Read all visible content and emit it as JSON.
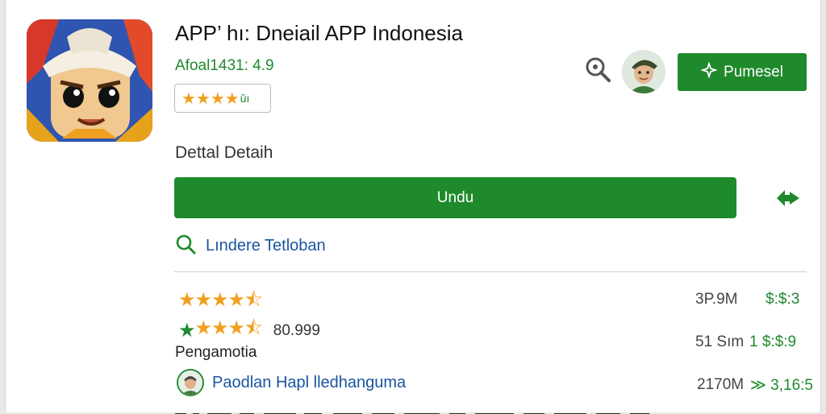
{
  "app": {
    "title": "APP’ hı: Dneiail APP Indonesia",
    "rating_line": "Afoal1431: 4.9",
    "stars": "★★★★",
    "stars_suffix": "ŭı"
  },
  "header": {
    "purchase_label": "Pumesel"
  },
  "detail": {
    "label": "Dettal Detaih",
    "download_label": "Undu",
    "update_label": "Lındere Tetloban"
  },
  "reviews": {
    "stars1_full": "★★★★",
    "stars1_half": "⯪",
    "stars1_empty": "",
    "stars2_green": "★",
    "stars2_rest": "★★★⯪",
    "count": "80.999",
    "label": "Pengamotia",
    "developer": "Paodlan Hapl lledhanguma"
  },
  "stats": {
    "row1": {
      "left": "3P.9M",
      "right": "$:$:3"
    },
    "row2": {
      "left": "51 Sım",
      "right": "1 $:$:9"
    },
    "row3": {
      "left": "2170M",
      "right": "≫ 3,16:5"
    }
  },
  "colors": {
    "accent_green": "#1f8a2c",
    "link_blue": "#1a55a0",
    "star_orange": "#f0a020"
  }
}
